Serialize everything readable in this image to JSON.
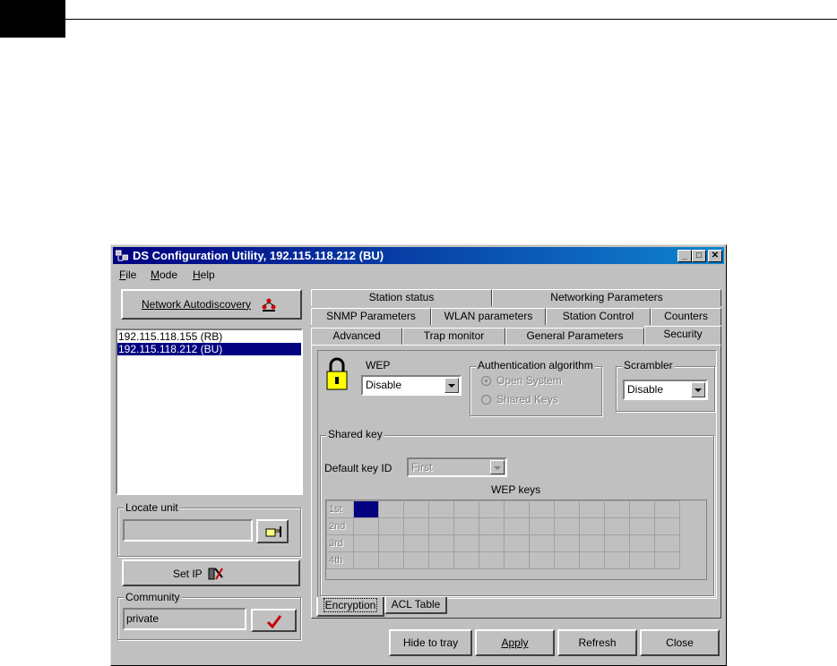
{
  "window": {
    "title": "DS Configuration Utility, 192.115.118.212  (BU)",
    "min": "_",
    "max": "□",
    "close": "✕"
  },
  "menu": [
    "File",
    "Mode",
    "Help"
  ],
  "left": {
    "autodiscovery_label": "Network Autodiscovery",
    "units": [
      "192.115.118.155  (RB)",
      "192.115.118.212  (BU)"
    ],
    "selected_unit_index": 1,
    "locate_title": "Locate unit",
    "locate_value": "",
    "set_ip_label": "Set IP",
    "community_title": "Community",
    "community_value": "private"
  },
  "tabs": {
    "row1": [
      "Station status",
      "Networking Parameters"
    ],
    "row2": [
      "SNMP Parameters",
      "WLAN parameters",
      "Station Control",
      "Counters"
    ],
    "row3": [
      "Advanced",
      "Trap monitor",
      "General Parameters",
      "Security"
    ],
    "active": "Security"
  },
  "security": {
    "wep_label": "WEP",
    "wep_value": "Disable",
    "auth_title": "Authentication algorithm",
    "auth_options": [
      "Open System",
      "Shared Keys"
    ],
    "scrambler_title": "Scrambler",
    "scrambler_value": "Disable",
    "shared_key_title": "Shared key",
    "default_key_label": "Default key ID",
    "default_key_value": "First",
    "wep_keys_label": "WEP keys",
    "key_rows": [
      "1st",
      "2nd",
      "3rd",
      "4th"
    ],
    "key_columns": 13
  },
  "subtabs": [
    "Encryption",
    "ACL Table"
  ],
  "active_subtab": "Encryption",
  "buttons": {
    "hide": "Hide to tray",
    "apply": "Apply",
    "refresh": "Refresh",
    "close": "Close"
  },
  "colors": {
    "title_bar": "#000080",
    "selection": "#000080",
    "checkmark": "#cc0000"
  }
}
